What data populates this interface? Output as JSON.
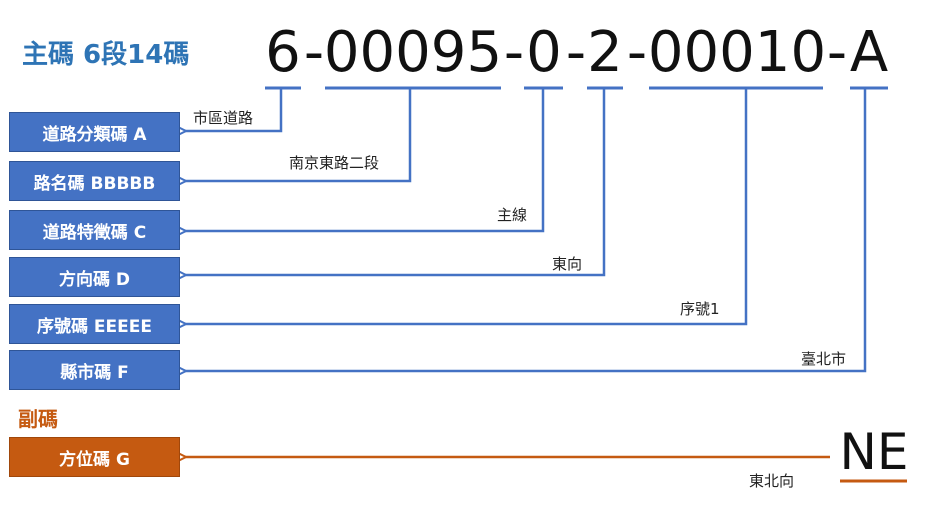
{
  "main_heading": "主碼 6段14碼",
  "sub_heading": "副碼",
  "code_segments": [
    {
      "text": "6"
    },
    {
      "text": "-"
    },
    {
      "text": "00095"
    },
    {
      "text": "-"
    },
    {
      "text": "0"
    },
    {
      "text": "-"
    },
    {
      "text": "2"
    },
    {
      "text": "-"
    },
    {
      "text": "00010"
    },
    {
      "text": "-"
    },
    {
      "text": "A"
    }
  ],
  "sub_code": "NE",
  "boxes": [
    {
      "label": "道路分類碼 A",
      "example": "市區道路"
    },
    {
      "label": "路名碼 BBBBB",
      "example": "南京東路二段"
    },
    {
      "label": "道路特徵碼 C",
      "example": "主線"
    },
    {
      "label": "方向碼 D",
      "example": "東向"
    },
    {
      "label": "序號碼 EEEEE",
      "example": "序號1"
    },
    {
      "label": "縣市碼 F",
      "example": "臺北市"
    }
  ],
  "sub_box": {
    "label": "方位碼 G",
    "example": "東北向"
  },
  "colors": {
    "main": "#4472c4",
    "heading_main": "#2e74b5",
    "sub": "#c55a11",
    "code_text": "#111111"
  }
}
